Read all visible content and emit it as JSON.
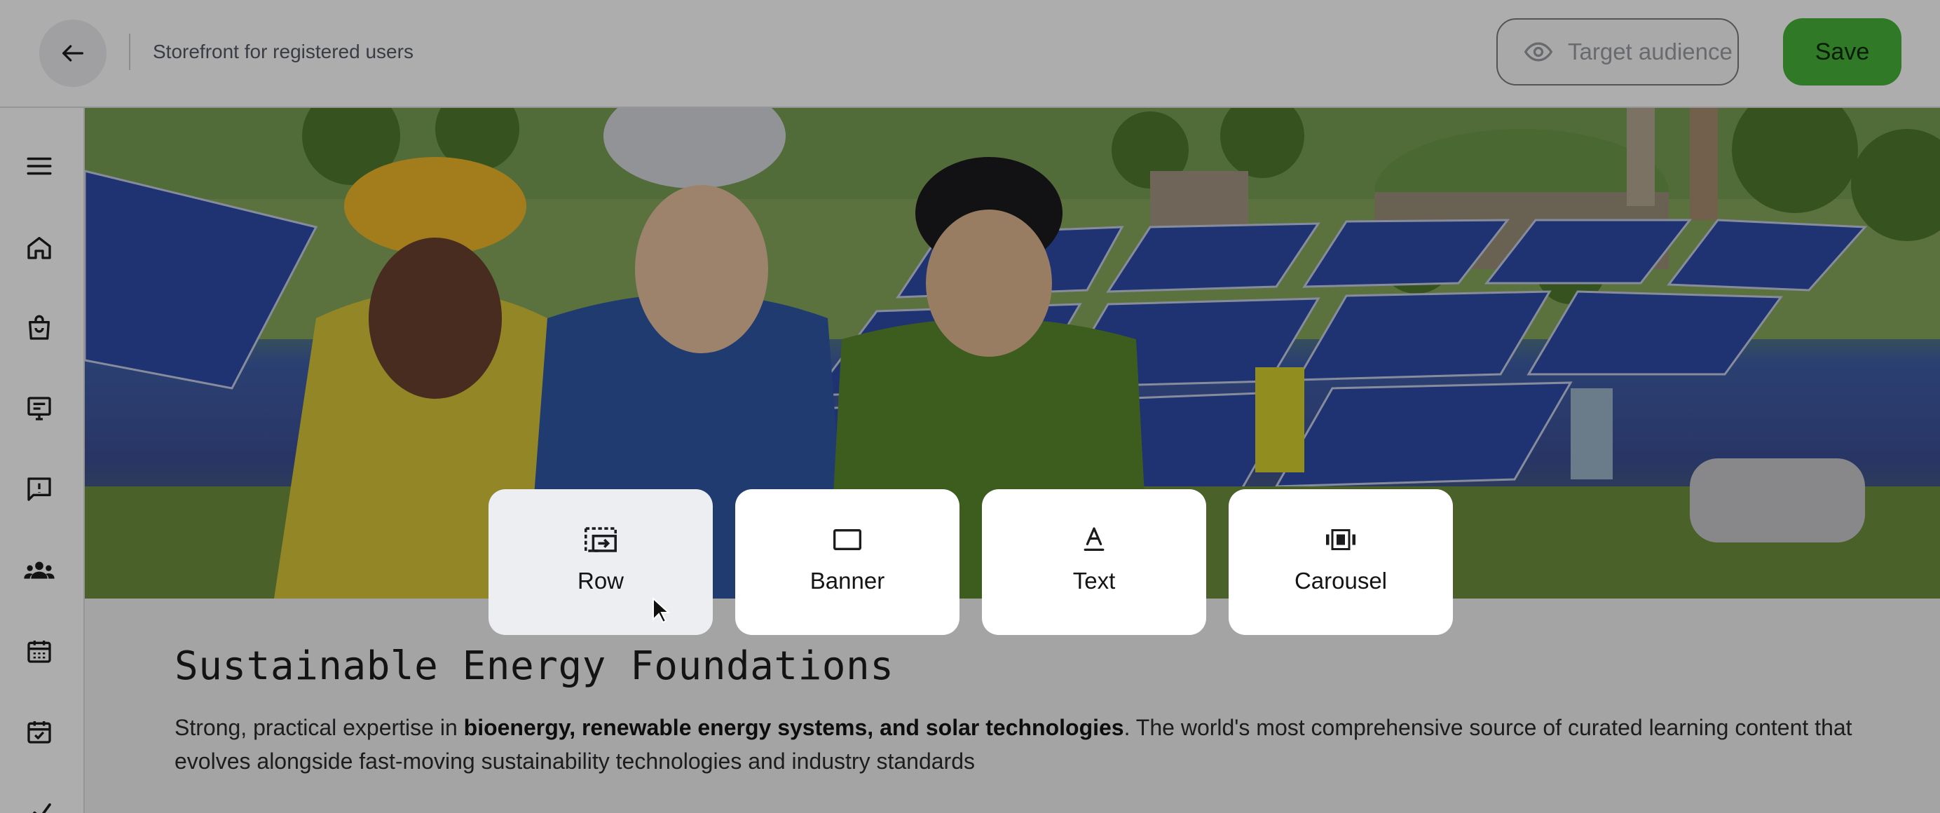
{
  "header": {
    "title": "Storefront for registered users",
    "target_audience_label": "Target audience",
    "save_label": "Save",
    "save_color": "#46b33a"
  },
  "sidebar": {
    "items": [
      {
        "icon": "menu-icon"
      },
      {
        "icon": "home-icon"
      },
      {
        "icon": "shopping-bag-icon"
      },
      {
        "icon": "content-icon"
      },
      {
        "icon": "feedback-icon"
      },
      {
        "icon": "users-icon"
      },
      {
        "icon": "calendar-icon"
      },
      {
        "icon": "calendar-check-icon"
      },
      {
        "icon": "analytics-icon"
      }
    ]
  },
  "content": {
    "hero_image": "solar-farm-workers-illustration",
    "title": "Sustainable Energy Foundations",
    "description_prefix": "Strong, practical expertise in ",
    "description_bold": "bioenergy, renewable energy systems, and solar technologies",
    "description_suffix": ". The world's most comprehensive source of curated learning content that evolves alongside fast-moving sustainability technologies and industry standards"
  },
  "block_picker": {
    "options": [
      {
        "label": "Row",
        "icon": "row-icon"
      },
      {
        "label": "Banner",
        "icon": "banner-icon"
      },
      {
        "label": "Text",
        "icon": "text-icon"
      },
      {
        "label": "Carousel",
        "icon": "carousel-icon"
      }
    ]
  }
}
